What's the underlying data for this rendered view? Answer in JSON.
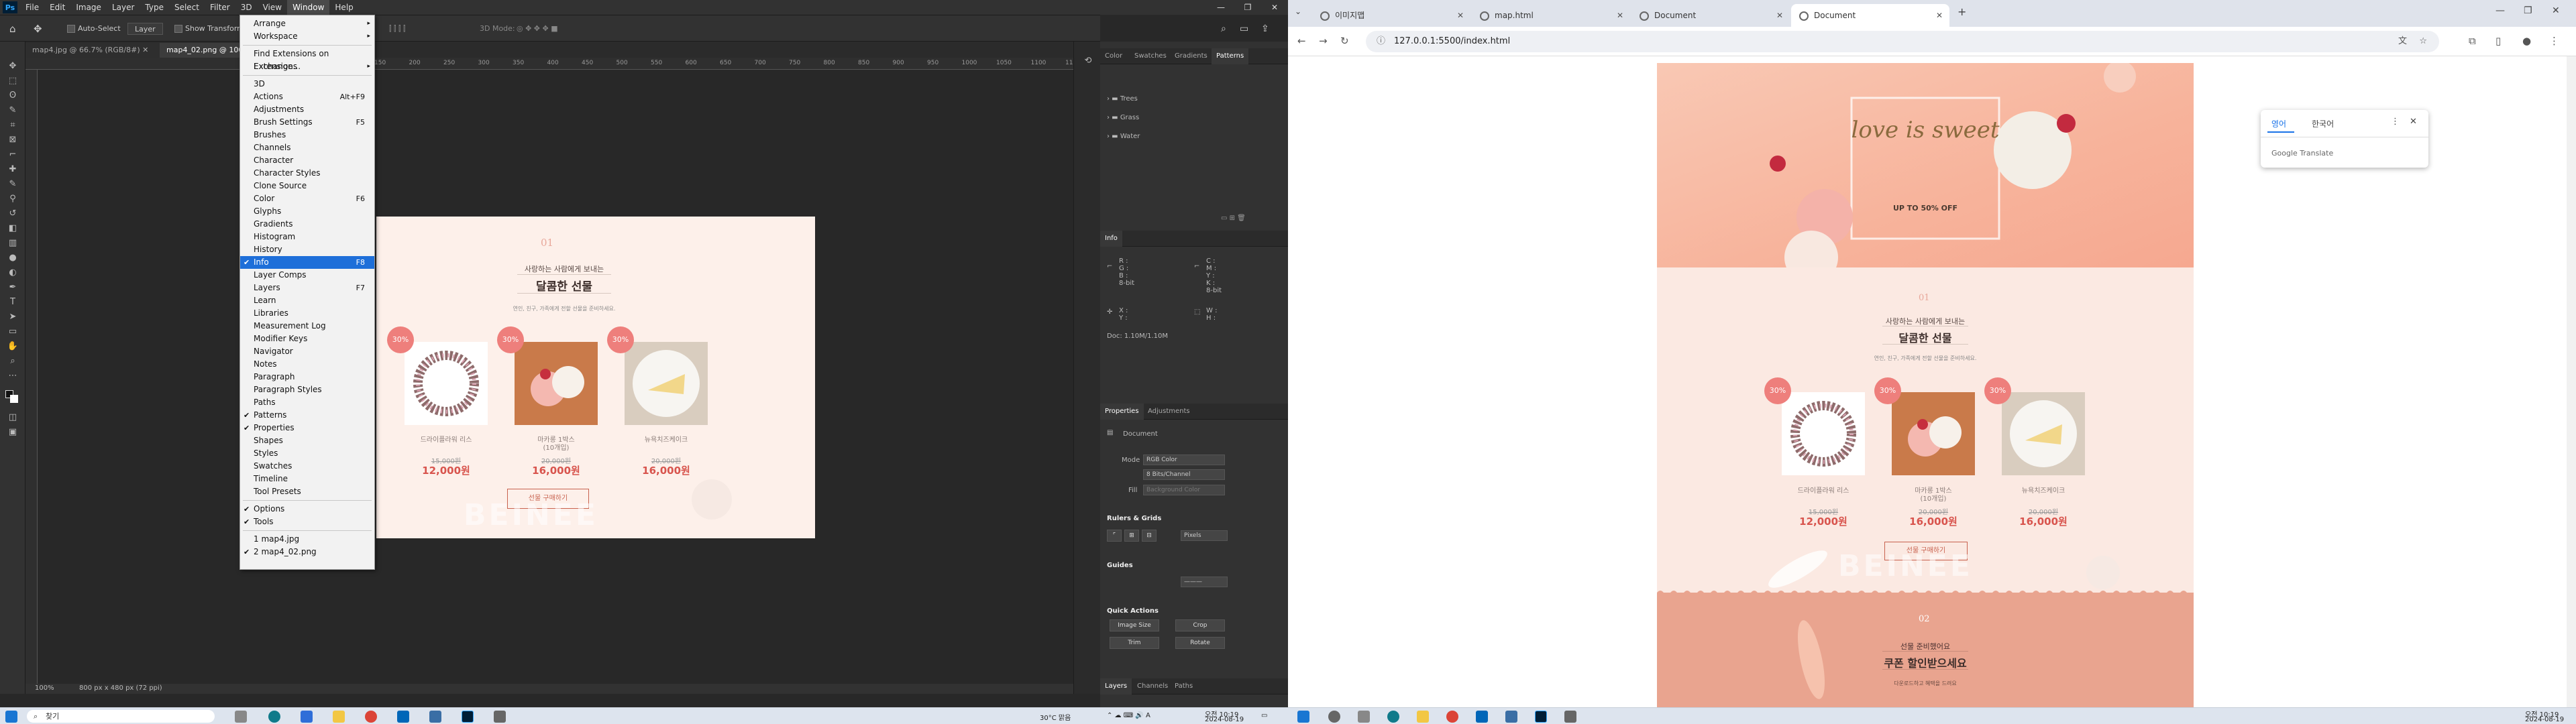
{
  "photoshop": {
    "menubar": [
      "File",
      "Edit",
      "Image",
      "Layer",
      "Type",
      "Select",
      "Filter",
      "3D",
      "View",
      "Window",
      "Help"
    ],
    "options": {
      "auto_select": "Auto-Select",
      "layer_select": "Layer",
      "show_transform": "Show Transform"
    },
    "mode_3d": "3D Mode:",
    "doc_tabs": [
      "map4.jpg @ 66.7% (RGB/8#)",
      "map4_02.png @ 100%"
    ],
    "ruler_numbers": [
      "150",
      "200",
      "250",
      "300",
      "350",
      "400",
      "450",
      "500",
      "550",
      "600",
      "650",
      "700",
      "750",
      "800",
      "850",
      "900",
      "950",
      "1000",
      "1050",
      "1100",
      "1150"
    ],
    "status": {
      "zoom": "100%",
      "size": "800 px x 480 px (72 ppi)"
    },
    "window_menu": {
      "items": [
        {
          "label": "Arrange",
          "arrow": "▸"
        },
        {
          "label": "Workspace",
          "arrow": "▸"
        },
        {
          "label": "Find Extensions on Exchange..."
        },
        {
          "label": "Extensions",
          "arrow": "▸"
        },
        {
          "label": "3D"
        },
        {
          "label": "Actions",
          "shortcut": "Alt+F9"
        },
        {
          "label": "Adjustments"
        },
        {
          "label": "Brush Settings",
          "shortcut": "F5"
        },
        {
          "label": "Brushes"
        },
        {
          "label": "Channels"
        },
        {
          "label": "Character"
        },
        {
          "label": "Character Styles"
        },
        {
          "label": "Clone Source"
        },
        {
          "label": "Color",
          "shortcut": "F6"
        },
        {
          "label": "Glyphs"
        },
        {
          "label": "Gradients"
        },
        {
          "label": "Histogram"
        },
        {
          "label": "History"
        },
        {
          "label": "Info",
          "shortcut": "F8",
          "check": "✔",
          "selected": true
        },
        {
          "label": "Layer Comps"
        },
        {
          "label": "Layers",
          "shortcut": "F7"
        },
        {
          "label": "Learn"
        },
        {
          "label": "Libraries"
        },
        {
          "label": "Measurement Log"
        },
        {
          "label": "Modifier Keys"
        },
        {
          "label": "Navigator"
        },
        {
          "label": "Notes"
        },
        {
          "label": "Paragraph"
        },
        {
          "label": "Paragraph Styles"
        },
        {
          "label": "Paths"
        },
        {
          "label": "Patterns",
          "check": "✔"
        },
        {
          "label": "Properties",
          "check": "✔"
        },
        {
          "label": "Shapes"
        },
        {
          "label": "Styles"
        },
        {
          "label": "Swatches"
        },
        {
          "label": "Timeline"
        },
        {
          "label": "Tool Presets"
        },
        {
          "label": "Options",
          "check": "✔"
        },
        {
          "label": "Tools",
          "check": "✔"
        },
        {
          "label": "1 map4.jpg"
        },
        {
          "label": "2 map4_02.png",
          "check": "✔"
        }
      ]
    },
    "artboard": {
      "num": "01",
      "subtitle": "사랑하는 사람에게 보내는",
      "title": "달콤한 선물",
      "desc": "연인, 친구, 가족에게 전할 선물을 준비하세요.",
      "badge": "30%",
      "products": [
        {
          "name": "드라이플라워 리스",
          "sub": "",
          "old": "15,000원",
          "new": "12,000원"
        },
        {
          "name": "마카롱 1박스",
          "sub": "(10개입)",
          "old": "20,000원",
          "new": "16,000원"
        },
        {
          "name": "뉴욕치즈케이크",
          "sub": "",
          "old": "20,000원",
          "new": "16,000원"
        }
      ],
      "button": "선물 구매하기",
      "watermark": "BEINEE"
    },
    "panels": {
      "top_tabs": [
        "Color",
        "Swatches",
        "Gradients",
        "Patterns"
      ],
      "pattern_groups": [
        "Trees",
        "Grass",
        "Water"
      ],
      "info_tab": "Info",
      "info_rows": [
        "R :",
        "G :",
        "B :",
        "8-bit",
        "C :",
        "M :",
        "Y :",
        "K :",
        "8-bit",
        "X :",
        "Y :",
        "W :",
        "H :"
      ],
      "doc_size": "Doc: 1.10M/1.10M",
      "props_tabs": [
        "Properties",
        "Adjustments"
      ],
      "props_doc": "Document",
      "mode_label": "Mode",
      "mode_value": "RGB Color",
      "depth_value": "8 Bits/Channel",
      "fill_label": "Fill",
      "bg_value": "Background Color",
      "rulers_grids": "Rulers & Grids",
      "units": "Pixels",
      "guides": "Guides",
      "quick_actions": "Quick Actions",
      "qa_buttons": [
        "Image Size",
        "Crop",
        "Trim",
        "Rotate"
      ],
      "bottom_tabs": [
        "Layers",
        "Channels",
        "Paths"
      ]
    }
  },
  "chrome": {
    "tabs": [
      {
        "title": "이미지맵"
      },
      {
        "title": "map.html"
      },
      {
        "title": "Document"
      },
      {
        "title": "Document"
      }
    ],
    "url": "127.0.0.1:5500/index.html",
    "translate": {
      "langs": [
        "영어",
        "한국어"
      ],
      "brand": "Google Translate"
    },
    "site": {
      "hero_script": "love is sweet",
      "hero_sub": "UP TO 50% OFF",
      "sec1_num": "01",
      "sec1_subtitle": "사랑하는 사람에게 보내는",
      "sec1_title": "달콤한 선물",
      "sec1_desc": "연인, 친구, 가족에게 전할 선물을 준비하세요.",
      "badge": "30%",
      "products": [
        {
          "name": "드라이플라워 리스",
          "sub": "",
          "old": "15,000원",
          "new": "12,000원"
        },
        {
          "name": "마카롱 1박스",
          "sub": "(10개입)",
          "old": "20,000원",
          "new": "16,000원"
        },
        {
          "name": "뉴욕치즈케이크",
          "sub": "",
          "old": "20,000원",
          "new": "16,000원"
        }
      ],
      "button": "선물 구매하기",
      "watermark": "BEINEE",
      "sec2_num": "02",
      "sec2_subtitle": "선물 준비했어요",
      "sec2_title": "쿠폰 할인받으세요",
      "sec2_desc": "다운로드하고 혜택을 드려요"
    }
  },
  "taskbar_left": {
    "search": "찾기",
    "weather": "30°C 맑음",
    "time": "오전 10:19",
    "date": "2024-08-19"
  },
  "taskbar_right": {
    "time": "오전 10:19",
    "date": "2024-08-19"
  }
}
